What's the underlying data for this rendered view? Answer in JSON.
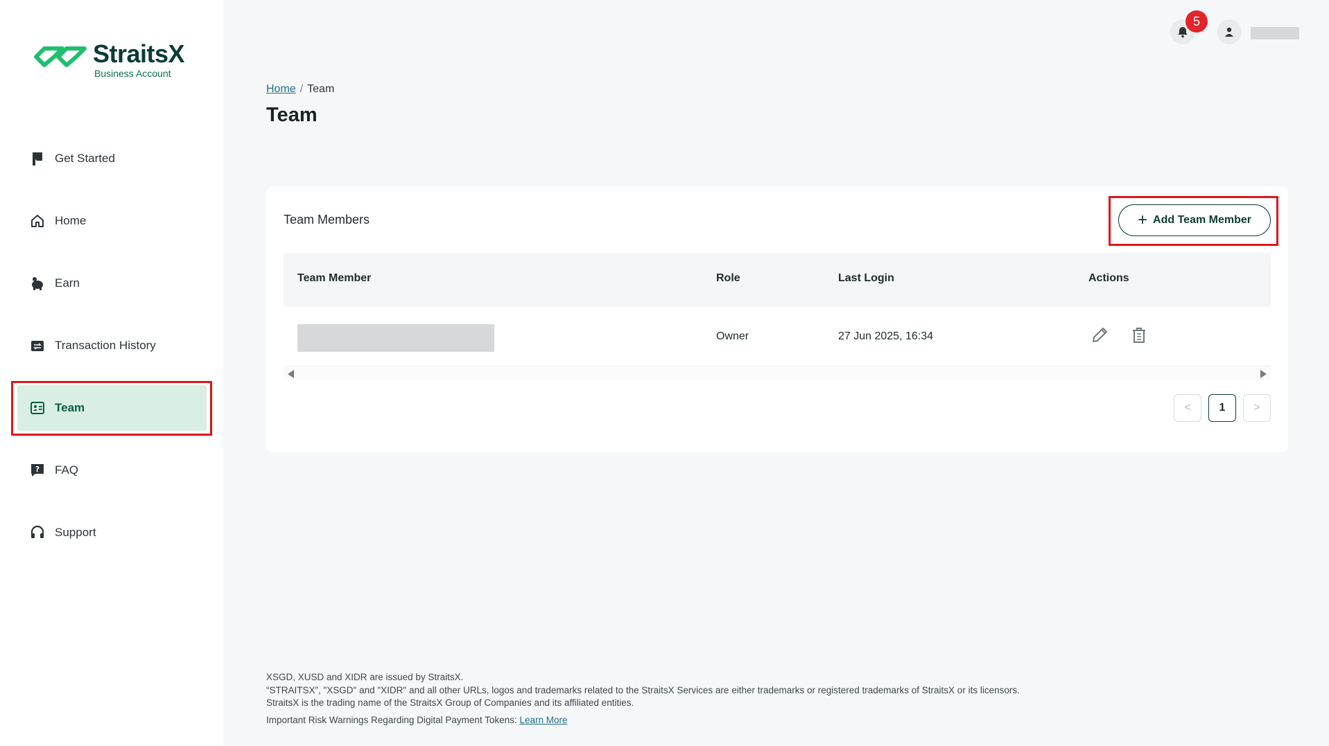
{
  "brand": {
    "name": "StraitsX",
    "subtitle": "Business Account",
    "colors": {
      "primary": "#0b3b36",
      "accent": "#1fbf6e",
      "active_bg": "#d9efe3",
      "highlight": "#e0151c"
    }
  },
  "sidebar": {
    "items": [
      {
        "label": "Get Started",
        "icon": "flag-icon"
      },
      {
        "label": "Home",
        "icon": "home-icon"
      },
      {
        "label": "Earn",
        "icon": "piggy-bank-icon"
      },
      {
        "label": "Transaction History",
        "icon": "transaction-history-icon"
      },
      {
        "label": "Team",
        "icon": "id-card-icon",
        "active": true
      },
      {
        "label": "FAQ",
        "icon": "faq-icon"
      },
      {
        "label": "Support",
        "icon": "headset-icon"
      }
    ]
  },
  "topbar": {
    "notification_count": "5",
    "bell_icon": "bell-icon",
    "avatar_icon": "user-icon"
  },
  "breadcrumb": {
    "home": "Home",
    "separator": "/",
    "current": "Team"
  },
  "page": {
    "title": "Team"
  },
  "card": {
    "title": "Team Members",
    "add_button": "Add Team Member",
    "columns": [
      "Team Member",
      "Role",
      "Last Login",
      "Actions"
    ],
    "rows": [
      {
        "member": "",
        "role": "Owner",
        "last_login": "27 Jun 2025, 16:34",
        "actions": [
          "edit-icon",
          "delete-icon"
        ]
      }
    ],
    "pagination": {
      "prev": "<",
      "current": "1",
      "next": ">"
    }
  },
  "footer": {
    "line1": "XSGD, XUSD and XIDR are issued by StraitsX.",
    "line2": "“STRAITSX”, \"XSGD\" and \"XIDR\" and all other URLs, logos and trademarks related to the StraitsX Services are either trademarks or registered trademarks of StraitsX or its licensors.",
    "line3": "StraitsX is the trading name of the StraitsX Group of Companies and its affiliated entities.",
    "risk_text": "Important Risk Warnings Regarding Digital Payment Tokens:",
    "learn_more": "Learn More"
  }
}
